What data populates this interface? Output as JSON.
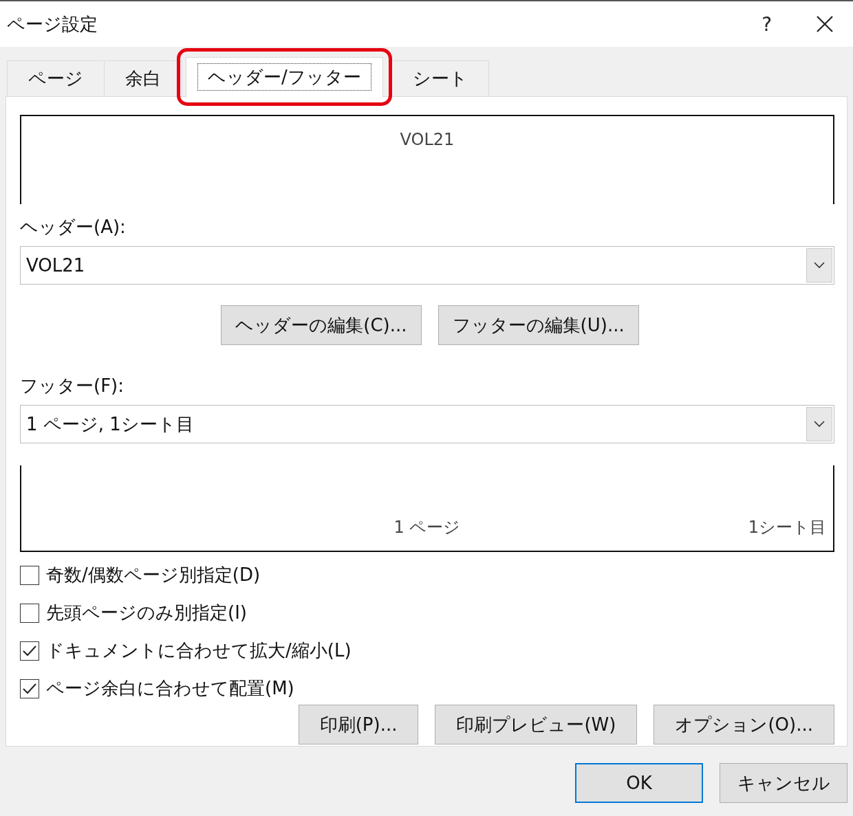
{
  "window": {
    "title": "ページ設定",
    "help": "?"
  },
  "tabs": [
    {
      "label": "ページ",
      "selected": false,
      "highlighted": false
    },
    {
      "label": "余白",
      "selected": false,
      "highlighted": false
    },
    {
      "label": "ヘッダー/フッター",
      "selected": true,
      "highlighted": true
    },
    {
      "label": "シート",
      "selected": false,
      "highlighted": false
    }
  ],
  "header_preview": {
    "center": "VOL21"
  },
  "header": {
    "label": "ヘッダー(A):",
    "value": "VOL21"
  },
  "edit_buttons": [
    "ヘッダーの編集(C)...",
    "フッターの編集(U)..."
  ],
  "footer": {
    "label": "フッター(F):",
    "value": "1 ページ, 1シート目"
  },
  "footer_preview": {
    "center": "1 ページ",
    "right": "1シート目"
  },
  "options": [
    {
      "label": "奇数/偶数ページ別指定(D)",
      "checked": false
    },
    {
      "label": "先頭ページのみ別指定(I)",
      "checked": false
    },
    {
      "label": "ドキュメントに合わせて拡大/縮小(L)",
      "checked": true
    },
    {
      "label": "ページ余白に合わせて配置(M)",
      "checked": true
    }
  ],
  "panel_buttons": [
    "印刷(P)...",
    "印刷プレビュー(W)",
    "オプション(O)..."
  ],
  "dialog_buttons": [
    {
      "label": "OK",
      "default": true
    },
    {
      "label": "キャンセル",
      "default": false
    }
  ]
}
